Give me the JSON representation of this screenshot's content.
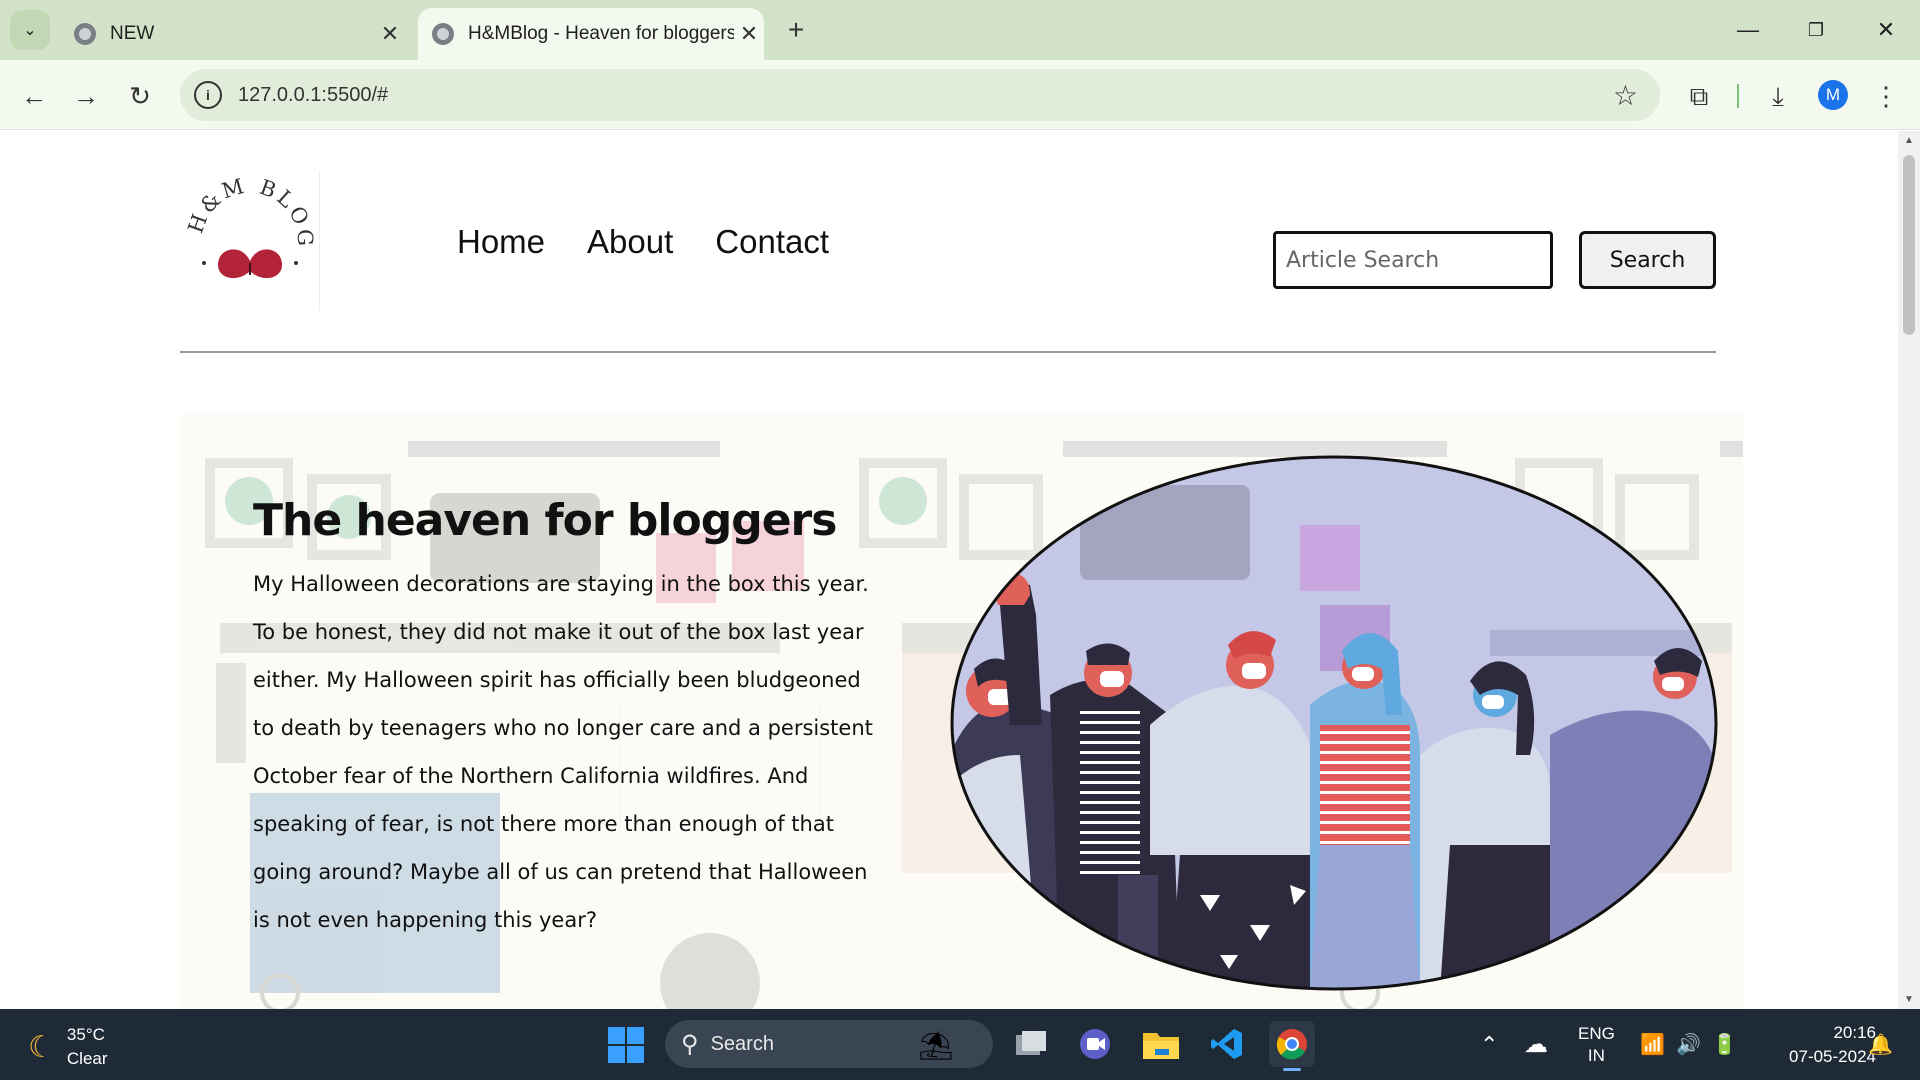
{
  "browser": {
    "tabs": [
      {
        "title": "NEW",
        "active": false
      },
      {
        "title": "H&MBlog - Heaven for bloggers",
        "active": true
      }
    ],
    "url": "127.0.0.1:5500/#",
    "profile_initial": "M"
  },
  "site": {
    "logo_text": "H&M BLOG",
    "nav": [
      "Home",
      "About",
      "Contact"
    ],
    "search": {
      "placeholder": "Article Search",
      "button_label": "Search"
    },
    "hero": {
      "title": "The heaven for bloggers",
      "body": "My Halloween decorations are staying in the box this year. To be honest, they did not make it out of the box last year either. My Halloween spirit has officially been bludgeoned to death by teenagers who no longer care and a persistent October fear of the Northern California wildfires. And speaking of fear, is not there more than enough of that going around? Maybe all of us can pretend that Halloween is not even happening this year?"
    }
  },
  "taskbar": {
    "weather": {
      "temp": "35°C",
      "condition": "Clear"
    },
    "search_label": "Search",
    "lang": {
      "line1": "ENG",
      "line2": "IN"
    },
    "time": "20:16",
    "date": "07-05-2024"
  },
  "colors": {
    "tabstrip": "#d3e3c9",
    "toolbar": "#f4f9f0",
    "taskbar": "#1f2a37",
    "accent": "#1a73e8"
  }
}
